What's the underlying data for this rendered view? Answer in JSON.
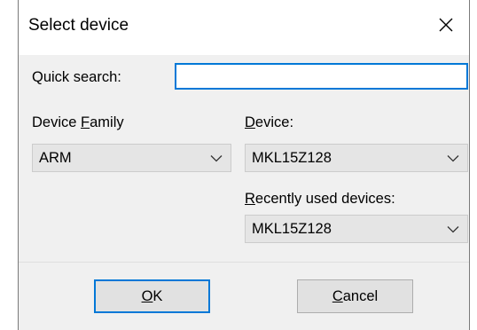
{
  "dialog": {
    "title": "Select device"
  },
  "quick_search": {
    "label": "Quick search:",
    "value": "",
    "placeholder": ""
  },
  "device_family": {
    "label_prefix": "Device ",
    "label_access": "F",
    "label_rest": "amily",
    "selected": "ARM"
  },
  "device": {
    "label_access": "D",
    "label_rest": "evice:",
    "selected": "MKL15Z128"
  },
  "recent": {
    "label_access": "R",
    "label_rest": "ecently used devices:",
    "selected": "MKL15Z128"
  },
  "buttons": {
    "ok_access": "O",
    "ok_rest": "K",
    "cancel_access": "C",
    "cancel_rest": "ancel"
  },
  "icons": {
    "close": "close-icon",
    "dropdown": "chevron-down-icon"
  },
  "colors": {
    "accent": "#0078d7",
    "dialog_bg": "#f0f0f0",
    "combo_bg": "#e5e5e5",
    "button_bg": "#e1e1e1"
  }
}
